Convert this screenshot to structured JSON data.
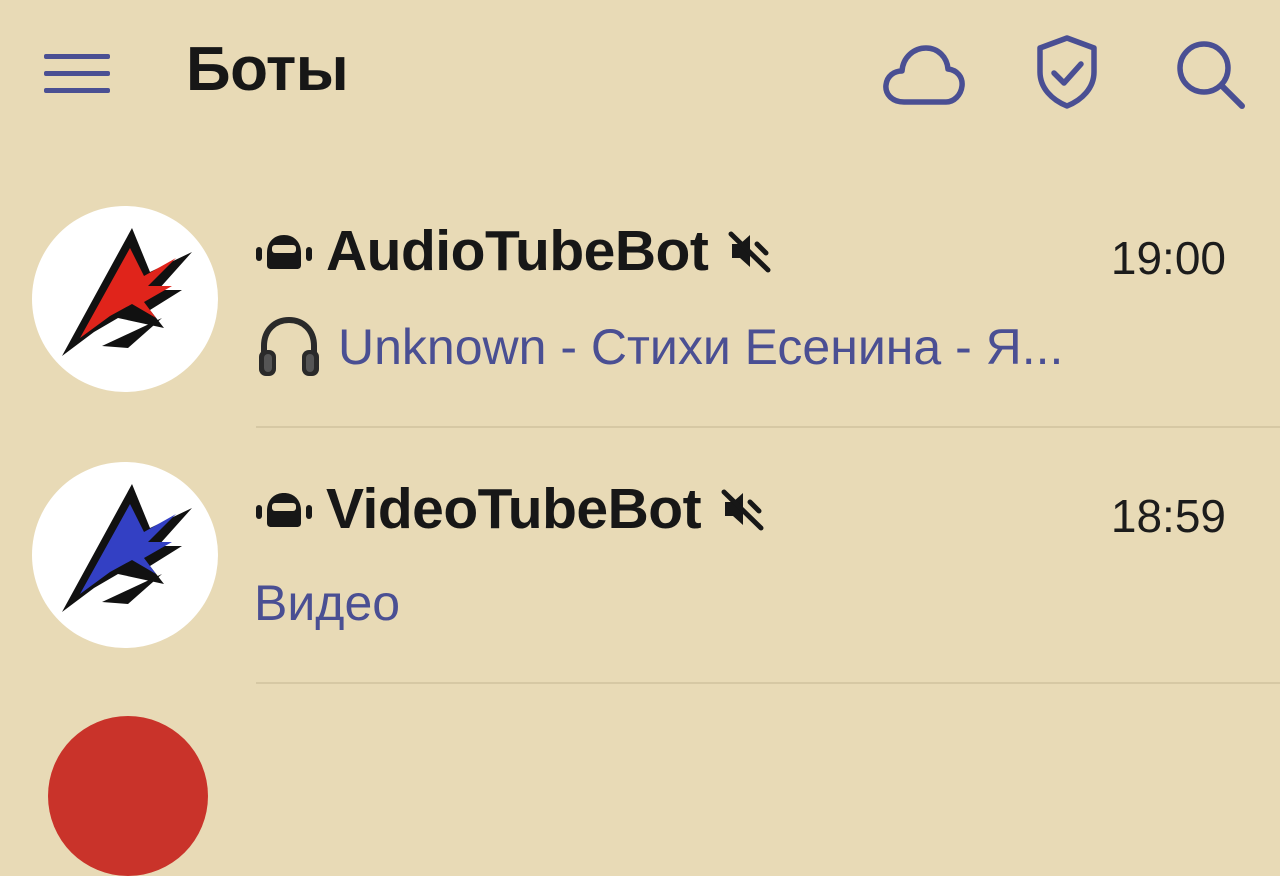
{
  "header": {
    "title": "Боты",
    "icons": [
      "menu-icon",
      "cloud-icon",
      "shield-check-icon",
      "search-icon"
    ]
  },
  "colors": {
    "background": "#e8dab6",
    "accent": "#4a4f93",
    "text": "#171717"
  },
  "chats": [
    {
      "name": "AudioTubeBot",
      "time": "19:00",
      "preview": "Unknown - Стихи Есенина  - Я...",
      "preview_icon": "headphones-icon",
      "muted": true,
      "avatar_accent": "#e0241b"
    },
    {
      "name": "VideoTubeBot",
      "time": "18:59",
      "preview": "Видео",
      "muted": true,
      "avatar_accent": "#3340c4"
    }
  ]
}
